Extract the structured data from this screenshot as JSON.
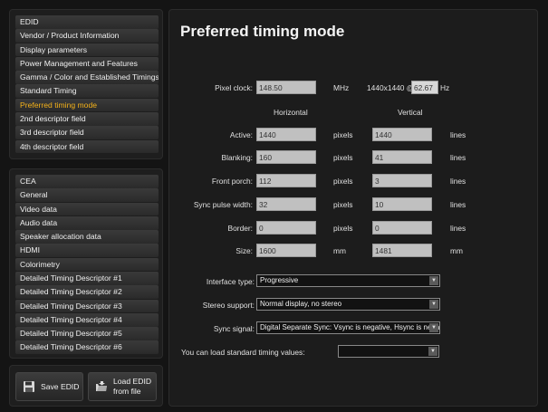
{
  "edid_menu": [
    "EDID",
    "Vendor / Product Information",
    "Display parameters",
    "Power Management and Features",
    "Gamma / Color and Established Timings",
    "Standard Timing",
    "Preferred timing mode",
    "2nd descriptor field",
    "3rd descriptor field",
    "4th descriptor field"
  ],
  "cea_menu": [
    "CEA",
    "General",
    "Video data",
    "Audio data",
    "Speaker allocation data",
    "HDMI",
    "Colorimetry",
    "Detailed Timing Descriptor #1",
    "Detailed Timing Descriptor #2",
    "Detailed Timing Descriptor #3",
    "Detailed Timing Descriptor #4",
    "Detailed Timing Descriptor #5",
    "Detailed Timing Descriptor #6"
  ],
  "buttons": {
    "save": "Save EDID",
    "load_1": "Load EDID",
    "load_2": "from file"
  },
  "main": {
    "title": "Preferred timing mode",
    "pixel_clock_label": "Pixel clock:",
    "pixel_clock_value": "148.50",
    "pixel_clock_unit": "MHz",
    "resolution_text": "1440x1440 @",
    "refresh_value": "62.67",
    "refresh_unit": "Hz",
    "horizontal_header": "Horizontal",
    "vertical_header": "Vertical",
    "rows": [
      {
        "label": "Active:",
        "h": "1440",
        "h_unit": "pixels",
        "v": "1440",
        "v_unit": "lines"
      },
      {
        "label": "Blanking:",
        "h": "160",
        "h_unit": "pixels",
        "v": "41",
        "v_unit": "lines"
      },
      {
        "label": "Front porch:",
        "h": "112",
        "h_unit": "pixels",
        "v": "3",
        "v_unit": "lines"
      },
      {
        "label": "Sync pulse width:",
        "h": "32",
        "h_unit": "pixels",
        "v": "10",
        "v_unit": "lines"
      },
      {
        "label": "Border:",
        "h": "0",
        "h_unit": "pixels",
        "v": "0",
        "v_unit": "lines"
      },
      {
        "label": "Size:",
        "h": "1600",
        "h_unit": "mm",
        "v": "1481",
        "v_unit": "mm"
      }
    ],
    "interface_label": "Interface type:",
    "interface_value": "Progressive",
    "stereo_label": "Stereo support:",
    "stereo_value": "Normal display, no stereo",
    "sync_label": "Sync signal:",
    "sync_value": "Digital Separate Sync: Vsync is negative, Hsync is negative",
    "standard_label": "You can load standard timing values:",
    "standard_value": ""
  },
  "colors": {
    "active_item": "#f5b21a",
    "field_bg": "#c0c0c0"
  }
}
